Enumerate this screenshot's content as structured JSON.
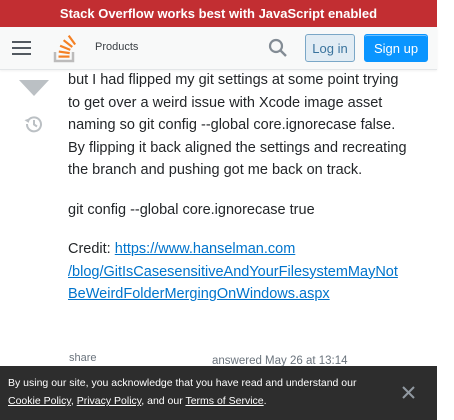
{
  "banner": {
    "text": "Stack Overflow works best with JavaScript enabled"
  },
  "header": {
    "products_label": "Products",
    "login_label": "Log in",
    "signup_label": "Sign up"
  },
  "post": {
    "paragraph1": "but I had flipped my git settings at some point trying to get over a weird issue with Xcode image asset naming so git config --global core.ignorecase false. By flipping it back aligned the settings and recreating the branch and pushing got me back on track.",
    "paragraph2": "git config --global core.ignorecase true",
    "credit_prefix": "Credit: ",
    "credit_link_line1": "https://www.hanselman.com",
    "credit_link_line2": "/blog/GitIsCasesensitiveAndYourFilesystemMayNot",
    "credit_link_line3": "BeWeirdFolderMergingOnWindows.aspx"
  },
  "footer": {
    "share_label": "share",
    "answered_text": "answered May 26 at 13:14"
  },
  "cookie_notice": {
    "text": "By using our site, you acknowledge that you have read and understand our",
    "cookie_policy": "Cookie Policy",
    "sep1": ", ",
    "privacy_policy": "Privacy Policy",
    "sep2": ", and our ",
    "terms": "Terms of Service",
    "end": "."
  },
  "colors": {
    "banner_bg": "#c22e32",
    "signup_bg": "#0a95ff",
    "login_bg": "#e1ecf4",
    "link": "#0074cc",
    "cookie_bg": "#2d2d2d"
  }
}
